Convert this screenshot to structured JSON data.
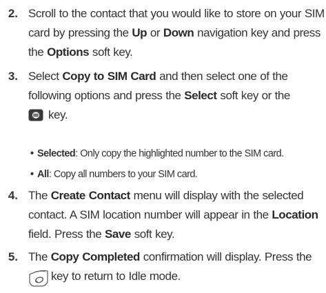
{
  "steps": [
    {
      "number": "2.",
      "parts": [
        "Scroll to the contact that you would like to store on your SIM card by pressing the ",
        "Up",
        " or ",
        "Down",
        " navigation key and press the ",
        "Options",
        " soft key."
      ]
    },
    {
      "number": "3.",
      "parts": [
        "Select ",
        "Copy to SIM Card",
        " and then select one of the following options and press the ",
        "Select",
        " soft key or the ",
        "key."
      ],
      "icon": "ok-center-key-icon",
      "bullets": [
        {
          "label": "Selected",
          "text": ": Only copy the highlighted number to the SIM card."
        },
        {
          "label": "All",
          "text": ": Copy all numbers to your SIM card."
        }
      ]
    },
    {
      "number": "4.",
      "parts": [
        "The ",
        "Create Contact",
        " menu will display with the selected contact. A SIM location number will appear in the ",
        "Location",
        " field. Press the ",
        "Save",
        " soft key."
      ]
    },
    {
      "number": "5.",
      "parts": [
        "The ",
        "Copy Completed",
        " confirmation will display. Press the ",
        "key to return to Idle mode."
      ],
      "icon": "end-key-icon"
    }
  ]
}
